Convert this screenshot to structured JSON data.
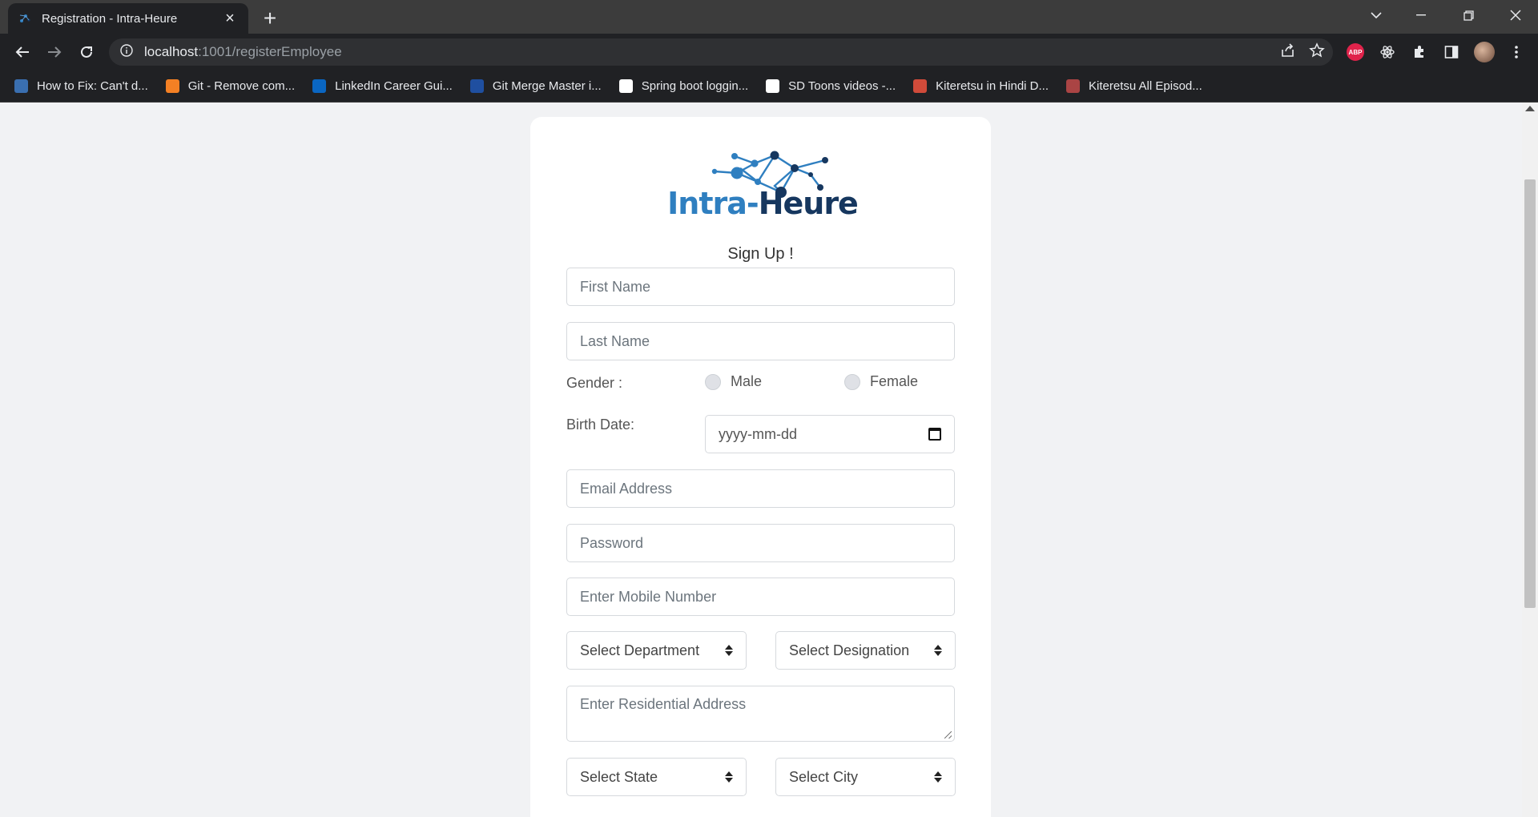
{
  "browser": {
    "tab_title": "Registration - Intra-Heure",
    "url_host": "localhost",
    "url_rest": ":1001/registerEmployee",
    "bookmarks": [
      {
        "label": "How to Fix: Can't d...",
        "icon": "laptop-icon",
        "color": "#3a6fb0"
      },
      {
        "label": "Git - Remove com...",
        "icon": "stackoverflow-icon",
        "color": "#f48024"
      },
      {
        "label": "LinkedIn Career Gui...",
        "icon": "linkedin-icon",
        "color": "#0a66c2"
      },
      {
        "label": "Git Merge Master i...",
        "icon": "t-icon",
        "color": "#1f4fa0"
      },
      {
        "label": "Spring boot loggin...",
        "icon": "p-icon",
        "color": "#ffffff"
      },
      {
        "label": "SD Toons videos -...",
        "icon": "d-icon",
        "color": "#ffffff"
      },
      {
        "label": "Kiteretsu in Hindi D...",
        "icon": "kiteretsu-icon",
        "color": "#d14b3a"
      },
      {
        "label": "Kiteretsu All Episod...",
        "icon": "grid-icon",
        "color": "#aa4444"
      }
    ]
  },
  "page": {
    "logo_part1": "Intra-",
    "logo_part2": "Heure",
    "heading": "Sign Up !",
    "first_name_placeholder": "First Name",
    "last_name_placeholder": "Last Name",
    "gender_label": "Gender :",
    "gender_options": [
      "Male",
      "Female"
    ],
    "birth_date_label": "Birth Date:",
    "birth_date_placeholder": "yyyy-mm-dd",
    "email_placeholder": "Email Address",
    "password_placeholder": "Password",
    "mobile_placeholder": "Enter Mobile Number",
    "department_select": "Select Department",
    "designation_select": "Select Designation",
    "address_placeholder": "Enter Residential Address",
    "state_select": "Select State",
    "city_select": "Select City"
  },
  "colors": {
    "logo_blue": "#2f7fc0",
    "logo_navy": "#16375f",
    "page_bg": "#f1f2f4"
  }
}
